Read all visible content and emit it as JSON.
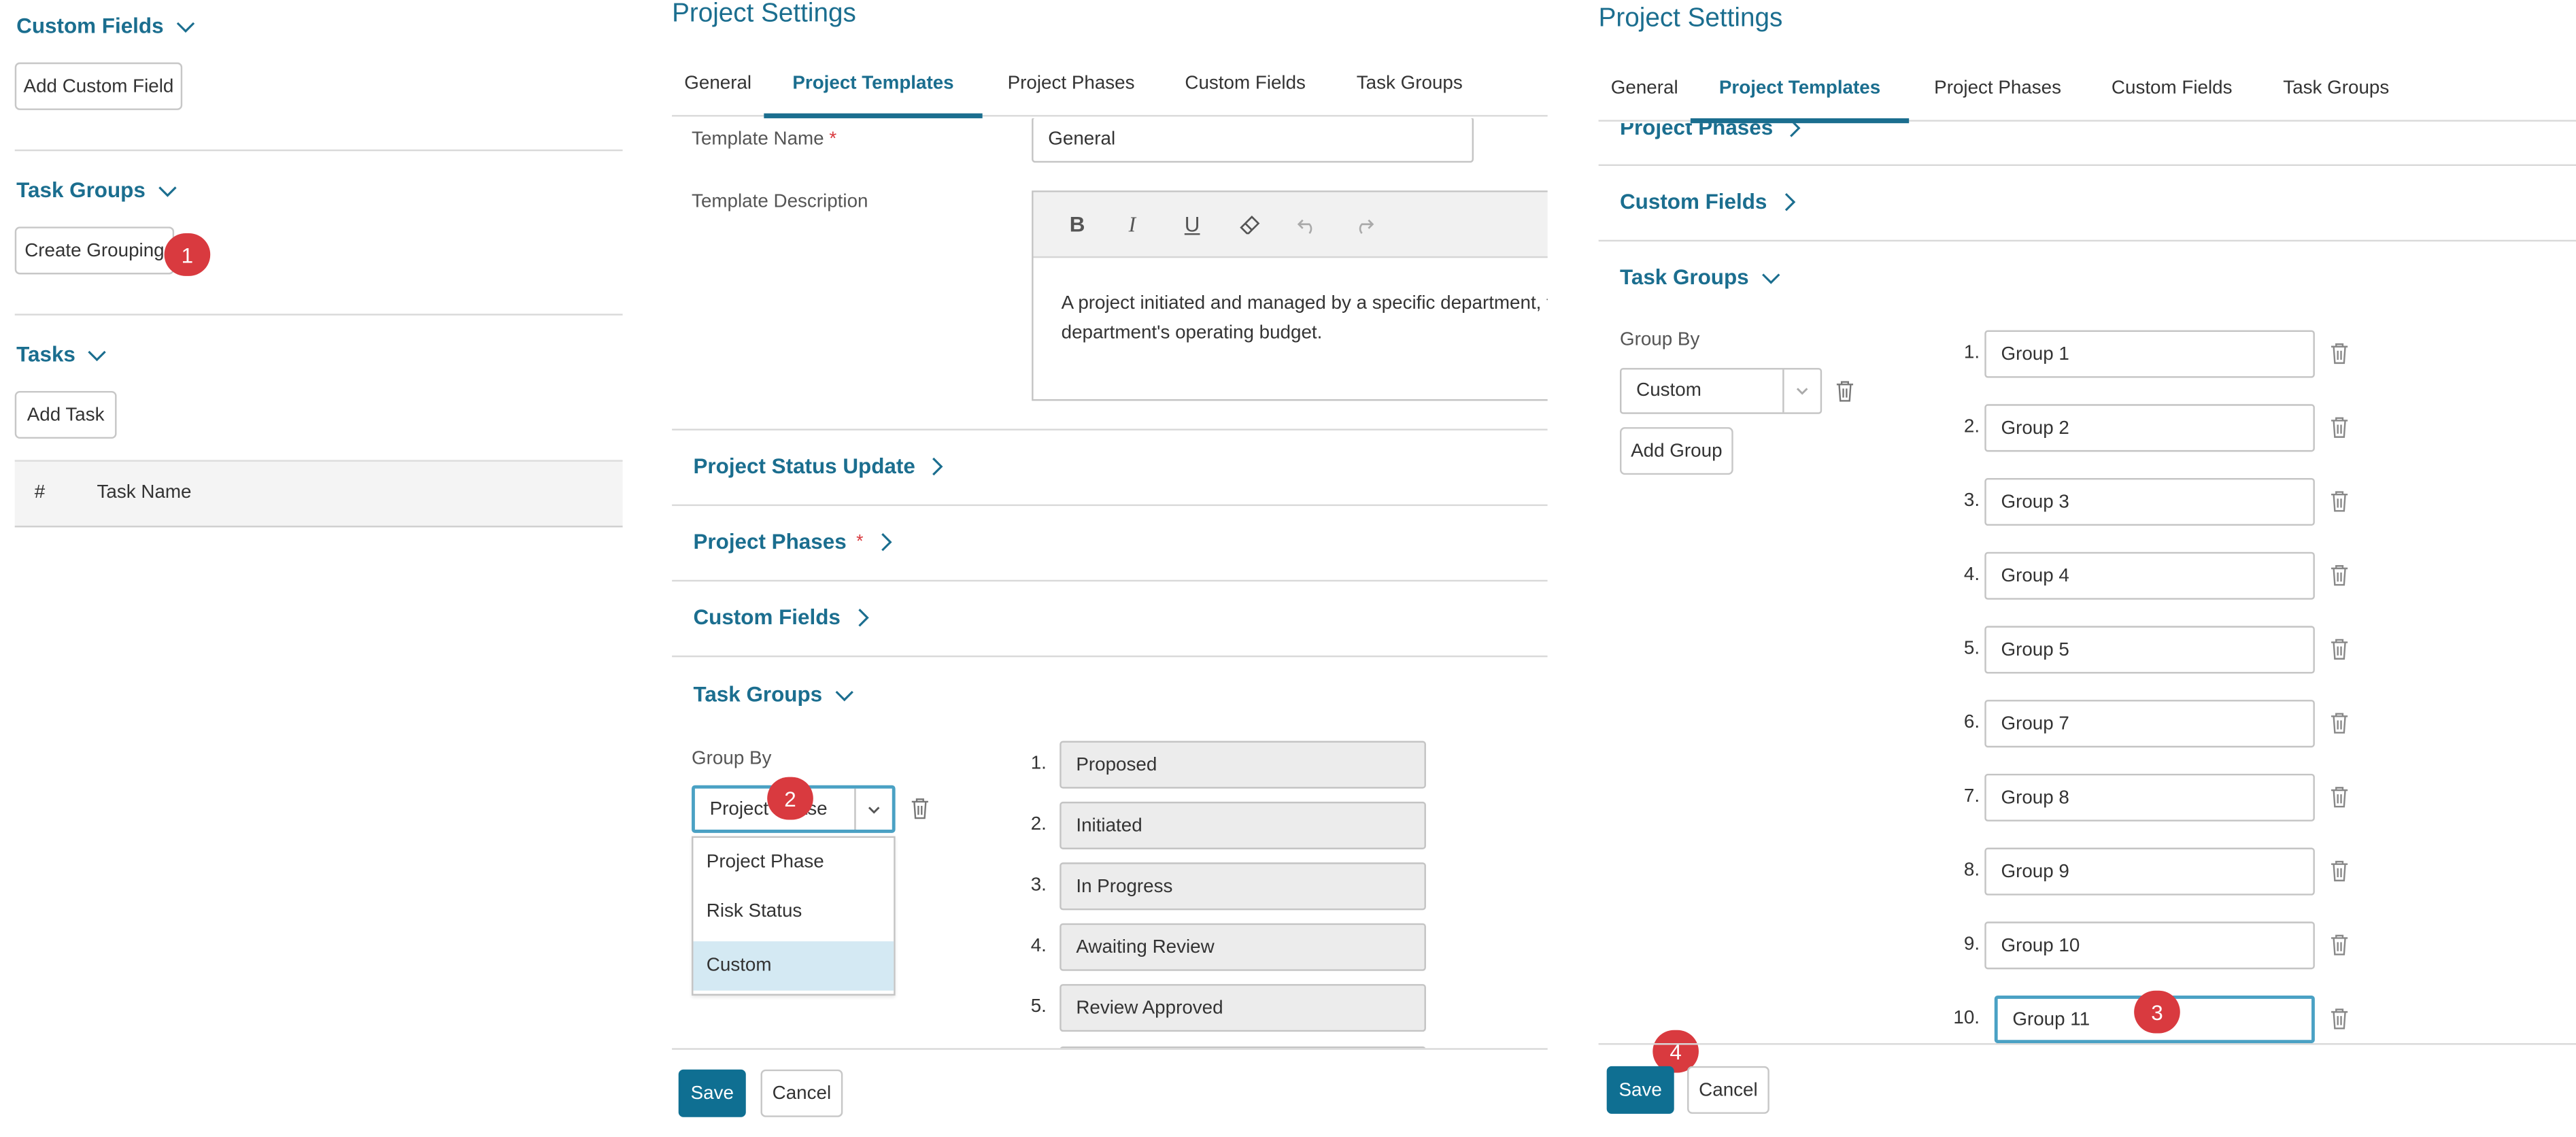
{
  "left_panel": {
    "custom_fields": {
      "title": "Custom Fields",
      "button": "Add Custom Field"
    },
    "task_groups": {
      "title": "Task Groups",
      "button": "Create Grouping"
    },
    "tasks": {
      "title": "Tasks",
      "button": "Add Task",
      "table_headers": [
        "#",
        "Task Name"
      ]
    }
  },
  "middle_panel": {
    "title": "Project Settings",
    "tabs": [
      "General",
      "Project Templates",
      "Project Phases",
      "Custom Fields",
      "Task Groups"
    ],
    "active_tab": "Project Templates",
    "template_name_label": "Template Name",
    "required_mark": "*",
    "template_name_value": "General",
    "template_description_label": "Template Description",
    "editor_toolbar": [
      "bold-icon",
      "italic-icon",
      "underline-icon",
      "eraser-icon",
      "undo-icon",
      "redo-icon"
    ],
    "editor_toolbar_glyphs": {
      "bold": "B",
      "italic": "I",
      "underline": "U"
    },
    "description_lines": [
      "A project initiated and managed by a specific department, fun",
      "department's operating budget."
    ],
    "sections": {
      "status_update": "Project Status Update",
      "phases": "Project Phases",
      "custom_fields": "Custom Fields",
      "task_groups": "Task Groups"
    },
    "group_by_label": "Group By",
    "group_by_value": "Project Phase",
    "dropdown_options": [
      "Project Phase",
      "Risk Status",
      "Custom"
    ],
    "highlighted_option": "Custom",
    "groups": [
      {
        "num": "1.",
        "value": "Proposed"
      },
      {
        "num": "2.",
        "value": "Initiated"
      },
      {
        "num": "3.",
        "value": "In Progress"
      },
      {
        "num": "4.",
        "value": "Awaiting Review"
      },
      {
        "num": "5.",
        "value": "Review Approved"
      }
    ],
    "save_label": "Save",
    "cancel_label": "Cancel"
  },
  "right_panel": {
    "title": "Project Settings",
    "tabs": [
      "General",
      "Project Templates",
      "Project Phases",
      "Custom Fields",
      "Task Groups"
    ],
    "active_tab": "Project Templates",
    "sections": {
      "phases": "Project Phases",
      "custom_fields": "Custom Fields",
      "task_groups": "Task Groups"
    },
    "group_by_label": "Group By",
    "group_by_value": "Custom",
    "add_group_label": "Add Group",
    "groups": [
      {
        "num": "1.",
        "value": "Group 1"
      },
      {
        "num": "2.",
        "value": "Group 2"
      },
      {
        "num": "3.",
        "value": "Group 3"
      },
      {
        "num": "4.",
        "value": "Group 4"
      },
      {
        "num": "5.",
        "value": "Group 5"
      },
      {
        "num": "6.",
        "value": "Group 7"
      },
      {
        "num": "7.",
        "value": "Group 8"
      },
      {
        "num": "8.",
        "value": "Group 9"
      },
      {
        "num": "9.",
        "value": "Group 10"
      },
      {
        "num": "10.",
        "value": "Group 11"
      }
    ],
    "save_label": "Save",
    "cancel_label": "Cancel"
  },
  "step_badges": [
    "1",
    "2",
    "3",
    "4"
  ],
  "colors": {
    "accent": "#1b6e8f",
    "primary_button": "#0f6f92",
    "badge": "#d93a3f",
    "option_highlight": "#d4e9f3",
    "focus_border": "#4aa1c4"
  }
}
